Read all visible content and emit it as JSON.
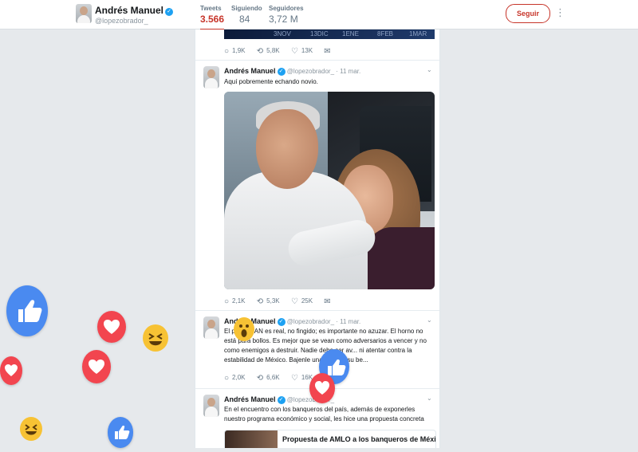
{
  "profile": {
    "name": "Andrés Manuel",
    "handle": "@lopezobrador_",
    "verified_mark": "✓",
    "avatar_icon": "profile-photo-icon"
  },
  "stats": [
    {
      "label": "Tweets",
      "value": "3.566",
      "active": true
    },
    {
      "label": "Siguiendo",
      "value": "84",
      "active": false
    },
    {
      "label": "Seguidores",
      "value": "3,72 M",
      "active": false
    }
  ],
  "follow_label": "Seguir",
  "more_icon": "⋮",
  "accent_color": "#c7352a",
  "banner_labels": [
    "3NOV",
    "13DIC",
    "1ENE",
    "8FEB",
    "1MAR"
  ],
  "icons": {
    "reply": "○",
    "retweet": "⟲",
    "like": "♡",
    "dm": "✉",
    "caret": "⌄"
  },
  "tweets": [
    {
      "actions": {
        "replies": "1,9K",
        "retweets": "5,8K",
        "likes": "13K"
      }
    },
    {
      "name": "Andrés Manuel",
      "handle": "@lopezobrador_",
      "time": "· 11 mar.",
      "text": "Aquí pobremente echando novio.",
      "actions": {
        "replies": "2,1K",
        "retweets": "5,3K",
        "likes": "25K"
      }
    },
    {
      "name": "Andrés Manuel",
      "handle": "@lopezobrador_",
      "time": "· 11 mar.",
      "text": "El pl... PRIAN es real, no fingido; es importante no azuzar. El horno no está para bollos. Es mejor que se vean como adversarios a vencer y no como enemigos a destruir. Nadie debe ser av... ni atentar contra la estabilidad de México. Bajenle una rayita a su be...",
      "actions": {
        "replies": "2,0K",
        "retweets": "6,6K",
        "likes": "16K"
      }
    },
    {
      "name": "Andrés Manuel",
      "handle": "@lopezobrador_",
      "time": "",
      "text": "En el encuentro con los banqueros del país, además de exponerles nuestro programa económico y social, les hice una propuesta concreta",
      "card_title": "Propuesta de AMLO a los banqueros de México"
    }
  ]
}
